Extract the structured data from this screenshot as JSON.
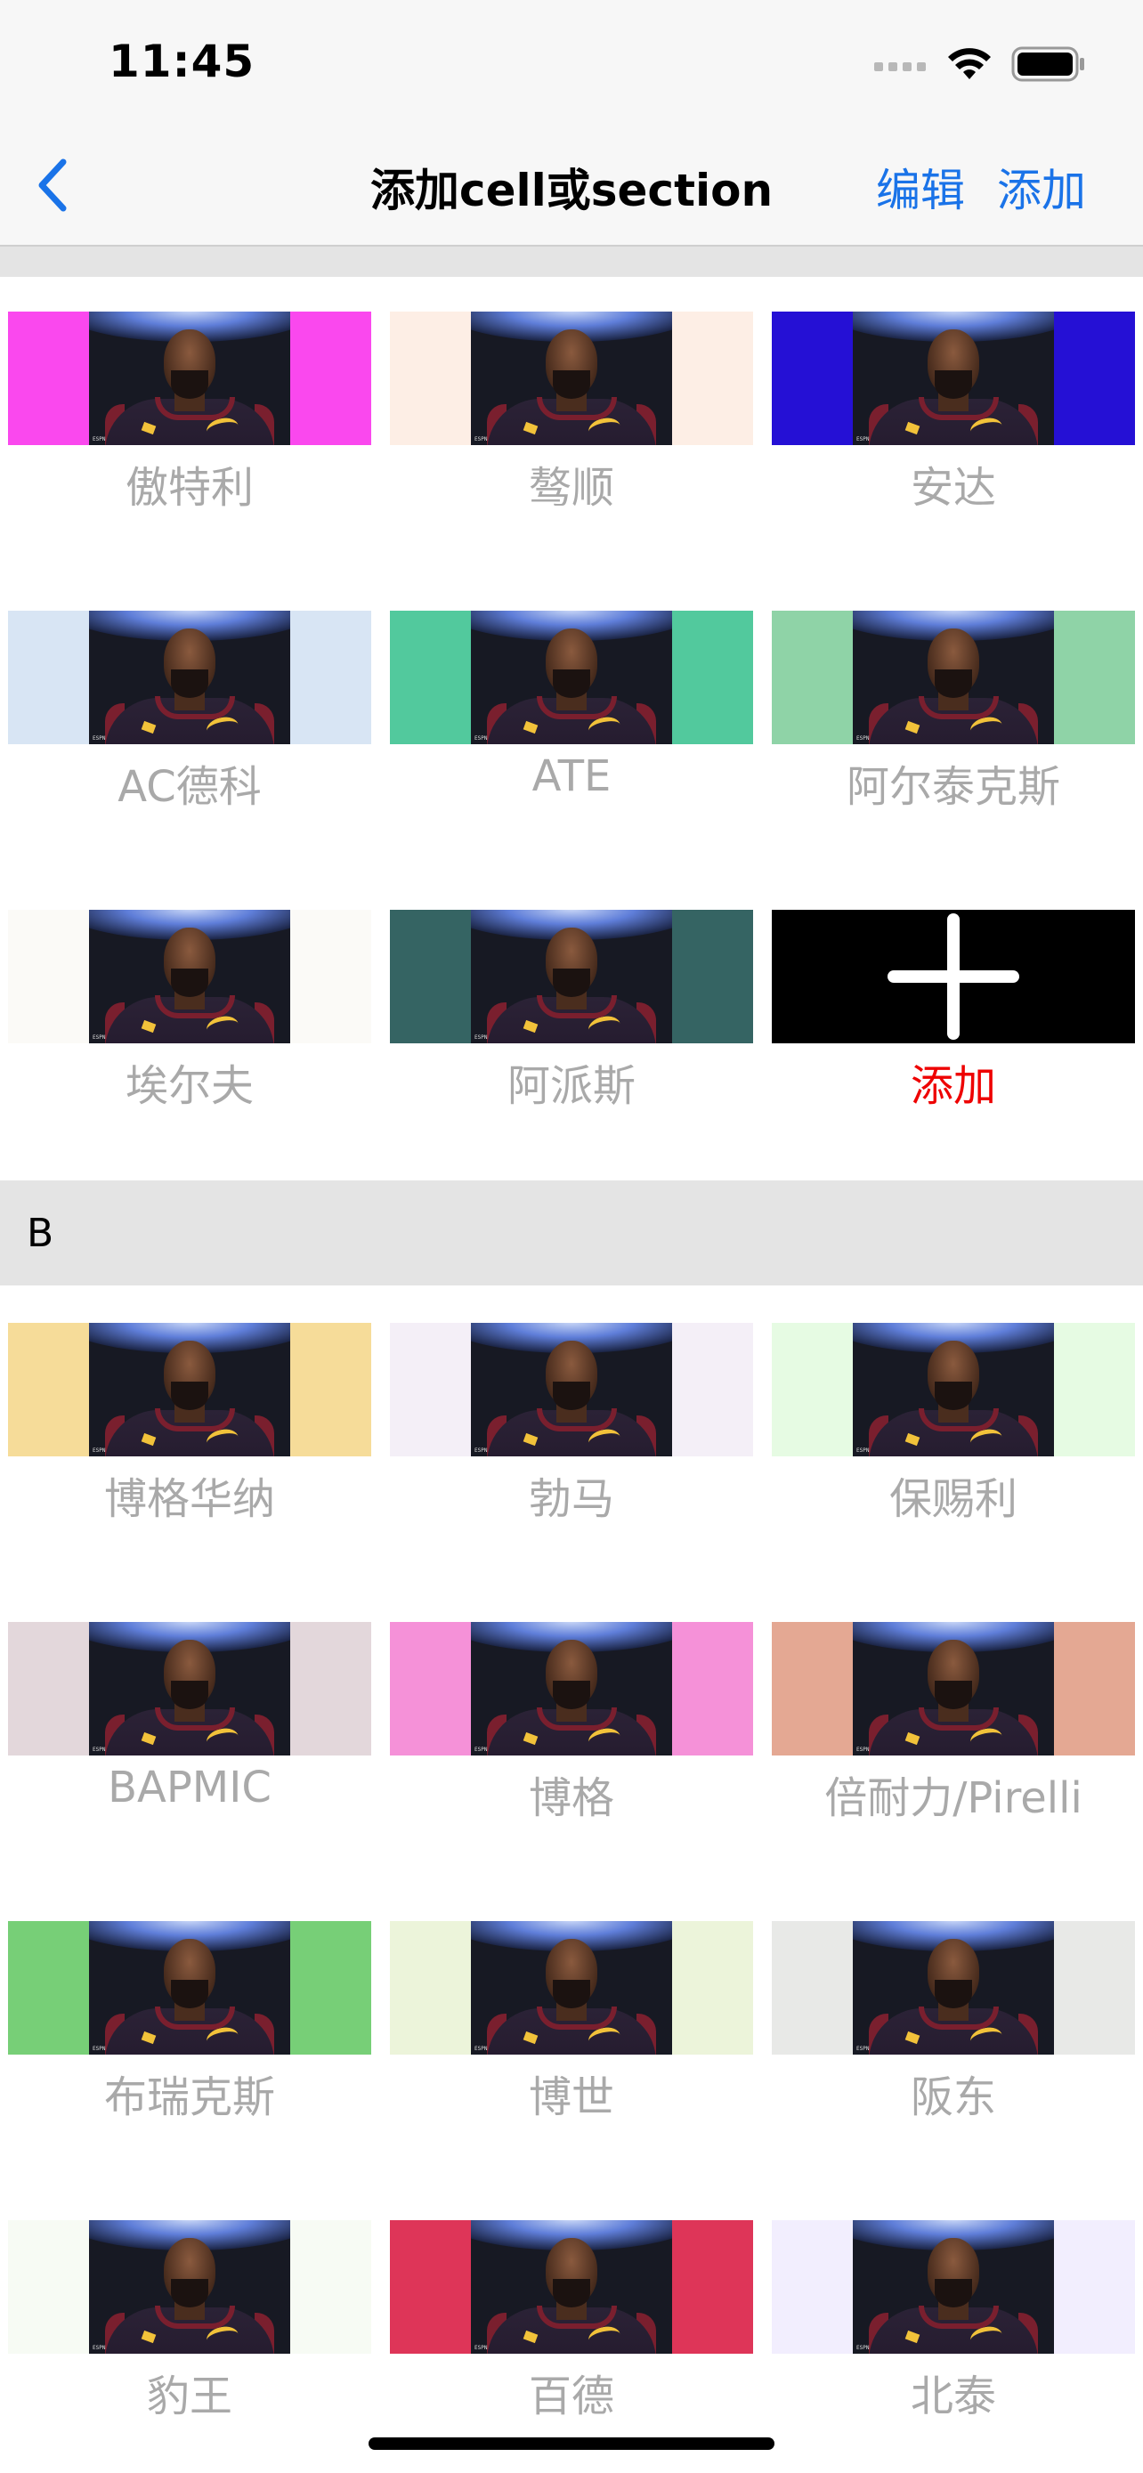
{
  "status": {
    "time": "11:45"
  },
  "nav": {
    "title": "添加cell或section",
    "edit_label": "编辑",
    "add_label": "添加"
  },
  "section_a": {
    "items": [
      {
        "label": "傲特利",
        "color": "#fa48ee"
      },
      {
        "label": "骜顺",
        "color": "#fdeee5"
      },
      {
        "label": "安达",
        "color": "#2510d5"
      },
      {
        "label": "AC德科",
        "color": "#d8e5f4"
      },
      {
        "label": "ATE",
        "color": "#52c99d"
      },
      {
        "label": "阿尔泰克斯",
        "color": "#8fd3a7"
      },
      {
        "label": "埃尔夫",
        "color": "#fbfaf7"
      },
      {
        "label": "阿派斯",
        "color": "#356463"
      }
    ],
    "add_cell": {
      "label": "添加",
      "color": "#ee0000"
    }
  },
  "section_b": {
    "title": "B",
    "items": [
      {
        "label": "博格华纳",
        "color": "#f6dc99"
      },
      {
        "label": "勃马",
        "color": "#f4eff7"
      },
      {
        "label": "保赐利",
        "color": "#e6fbe3"
      },
      {
        "label": "BAPMIC",
        "color": "#e3d7db"
      },
      {
        "label": "博格",
        "color": "#f591d8"
      },
      {
        "label": "倍耐力/Pirelli",
        "color": "#e4a893"
      },
      {
        "label": "布瑞克斯",
        "color": "#77cf77"
      },
      {
        "label": "博世",
        "color": "#ecf4da"
      },
      {
        "label": "阪东",
        "color": "#e8e9e7"
      },
      {
        "label": "豹王",
        "color": "#f7fbf4"
      },
      {
        "label": "百德",
        "color": "#de3558"
      },
      {
        "label": "北泰",
        "color": "#f2eefe"
      }
    ]
  }
}
